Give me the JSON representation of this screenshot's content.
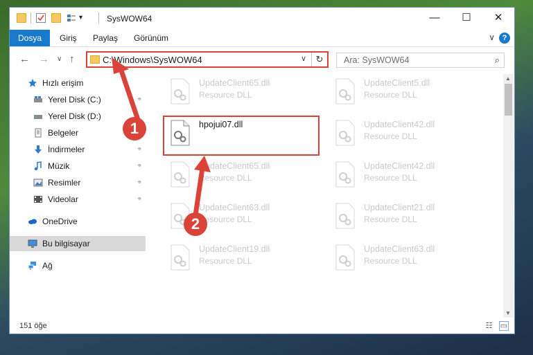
{
  "window": {
    "title": "SysWOW64",
    "quick_access_dropdown": "▾",
    "minimize": "—",
    "maximize": "☐",
    "close": "✕"
  },
  "ribbon": {
    "tabs": [
      {
        "label": "Dosya",
        "active": true
      },
      {
        "label": "Giriş"
      },
      {
        "label": "Paylaş"
      },
      {
        "label": "Görünüm"
      }
    ],
    "collapse": "∨",
    "help": "?"
  },
  "nav": {
    "back": "←",
    "forward": "→",
    "recent": "∨",
    "up": "↑",
    "address": "C:\\Windows\\SysWOW64",
    "address_dropdown": "∨",
    "refresh": "↻",
    "search_placeholder": "Ara: SysWOW64",
    "search_icon": "⌕"
  },
  "sidebar": {
    "items": [
      {
        "label": "Hızlı erişim",
        "icon": "star-icon",
        "pinned": false
      },
      {
        "label": "Yerel Disk (C:)",
        "icon": "drive-icon",
        "pinned": true
      },
      {
        "label": "Yerel Disk (D:)",
        "icon": "drive-icon",
        "pinned": false
      },
      {
        "label": "Belgeler",
        "icon": "document-icon",
        "pinned": true
      },
      {
        "label": "İndirmeler",
        "icon": "download-icon",
        "pinned": true
      },
      {
        "label": "Müzik",
        "icon": "music-icon",
        "pinned": true
      },
      {
        "label": "Resimler",
        "icon": "pictures-icon",
        "pinned": true
      },
      {
        "label": "Videolar",
        "icon": "video-icon",
        "pinned": true
      },
      {
        "label": "OneDrive",
        "icon": "cloud-icon",
        "pinned": false
      },
      {
        "label": "Bu bilgisayar",
        "icon": "computer-icon",
        "pinned": false,
        "selected": true
      },
      {
        "label": "Ağ",
        "icon": "network-icon",
        "pinned": false
      }
    ],
    "pin_glyph": "📌"
  },
  "files": {
    "left": [
      {
        "name": "UpdateClient65.dll",
        "type": "Resource DLL"
      },
      {
        "name": "hpojui07.dll",
        "type": ""
      },
      {
        "name": "UpdateClient65.dll",
        "type": "Resource DLL"
      },
      {
        "name": "UpdateClient63.dll",
        "type": "Resource DLL"
      },
      {
        "name": "UpdateClient19.dll",
        "type": "Resource DLL"
      }
    ],
    "right": [
      {
        "name": "UpdateClient5.dll",
        "type": "Resource DLL"
      },
      {
        "name": "UpdateClient42.dll",
        "type": "Resource DLL"
      },
      {
        "name": "UpdateClient42.dll",
        "type": "Resource DLL"
      },
      {
        "name": "UpdateClient21.dll",
        "type": "Resource DLL"
      },
      {
        "name": "UpdateClient63.dll",
        "type": "Resource DLL"
      }
    ]
  },
  "annotations": {
    "badge1": "1",
    "badge2": "2",
    "color": "#d9433a"
  },
  "status": {
    "count": "151 öğe"
  }
}
